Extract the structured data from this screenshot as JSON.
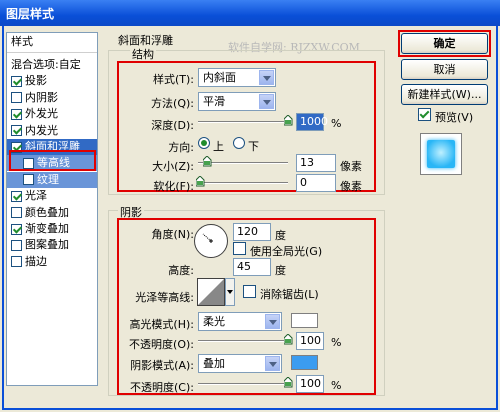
{
  "window": {
    "title": "图层样式"
  },
  "watermark": "软件自学网: RJZXW.COM",
  "style_list": {
    "header": "样式",
    "items": [
      {
        "label": "混合选项:自定",
        "checkbox": false,
        "checked": false,
        "state": "normal"
      },
      {
        "label": "投影",
        "checkbox": true,
        "checked": true,
        "state": "normal"
      },
      {
        "label": "内阴影",
        "checkbox": true,
        "checked": false,
        "state": "normal"
      },
      {
        "label": "外发光",
        "checkbox": true,
        "checked": true,
        "state": "normal"
      },
      {
        "label": "内发光",
        "checkbox": true,
        "checked": true,
        "state": "normal"
      },
      {
        "label": "斜面和浮雕",
        "checkbox": true,
        "checked": true,
        "state": "selected"
      },
      {
        "label": "等高线",
        "checkbox": true,
        "checked": false,
        "state": "sub"
      },
      {
        "label": "纹理",
        "checkbox": true,
        "checked": false,
        "state": "sub"
      },
      {
        "label": "光泽",
        "checkbox": true,
        "checked": true,
        "state": "normal"
      },
      {
        "label": "颜色叠加",
        "checkbox": true,
        "checked": false,
        "state": "normal"
      },
      {
        "label": "渐变叠加",
        "checkbox": true,
        "checked": true,
        "state": "normal"
      },
      {
        "label": "图案叠加",
        "checkbox": true,
        "checked": false,
        "state": "normal"
      },
      {
        "label": "描边",
        "checkbox": true,
        "checked": false,
        "state": "normal"
      }
    ]
  },
  "bevel": {
    "section_title": "斜面和浮雕",
    "structure_title": "结构",
    "style_label": "样式(T):",
    "style_value": "内斜面",
    "technique_label": "方法(Q):",
    "technique_value": "平滑",
    "depth_label": "深度(D):",
    "depth_value": "1000",
    "depth_unit": "%",
    "direction_label": "方向:",
    "dir_up": "上",
    "dir_down": "下",
    "size_label": "大小(Z):",
    "size_value": "13",
    "size_unit": "像素",
    "soften_label": "软化(F):",
    "soften_value": "0",
    "soften_unit": "像素"
  },
  "shading": {
    "title": "阴影",
    "angle_label": "角度(N):",
    "angle_value": "120",
    "angle_unit": "度",
    "global_light_label": "使用全局光(G)",
    "altitude_label": "高度:",
    "altitude_value": "45",
    "altitude_unit": "度",
    "gloss_label": "光泽等高线:",
    "antialias_label": "消除锯齿(L)",
    "highlight_label": "高光模式(H):",
    "highlight_value": "柔光",
    "highlight_color": "#ffffff",
    "highlight_opacity_label": "不透明度(O):",
    "highlight_opacity_value": "100",
    "shadow_label": "阴影模式(A):",
    "shadow_value": "叠加",
    "shadow_color": "#3b9cf0",
    "shadow_opacity_label": "不透明度(C):",
    "shadow_opacity_value": "100",
    "percent": "%"
  },
  "buttons": {
    "ok": "确定",
    "cancel": "取消",
    "new_style": "新建样式(W)...",
    "preview_label": "预览(V)"
  },
  "colors": {
    "accent": "#316ac5",
    "highlight_red": "#e00000",
    "preview_blue": "#29b6f6"
  }
}
